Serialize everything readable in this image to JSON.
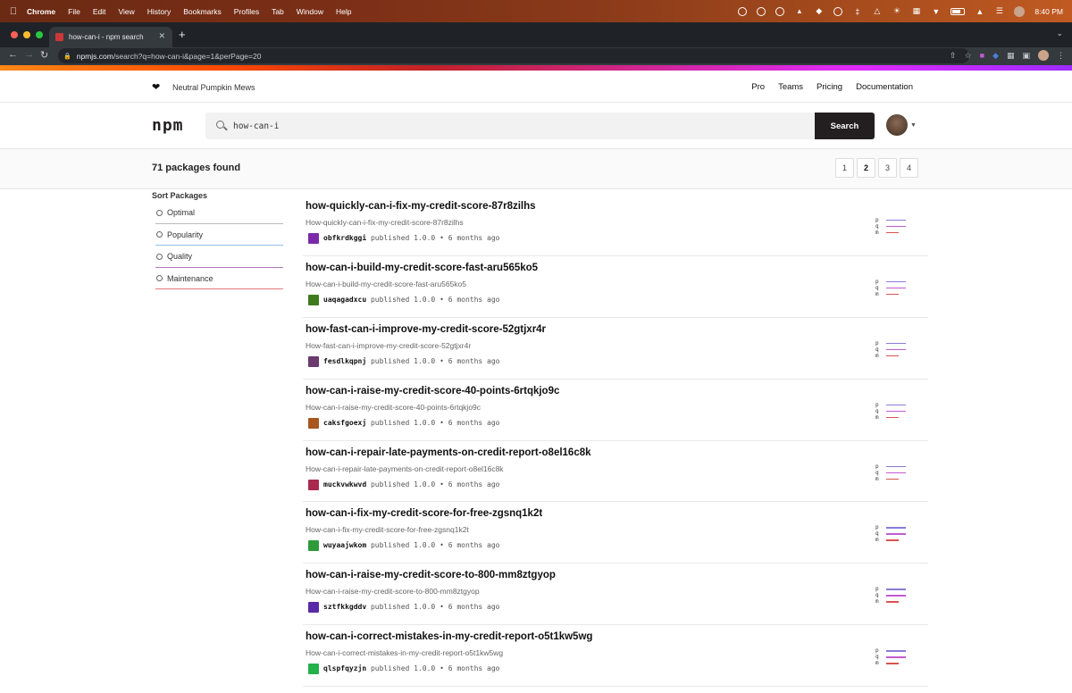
{
  "menubar": {
    "app_name": "Chrome",
    "menus": [
      "File",
      "Edit",
      "View",
      "History",
      "Bookmarks",
      "Profiles",
      "Tab",
      "Window",
      "Help"
    ],
    "time": "8:40 PM"
  },
  "browser": {
    "tab_title": "how-can-i - npm search",
    "url_host": "npmjs.com",
    "url_path": "/search?q=how-can-i&page=1&perPage=20"
  },
  "header": {
    "slogan": "Neutral Pumpkin Mews",
    "nav": [
      "Pro",
      "Teams",
      "Pricing",
      "Documentation"
    ],
    "logo": "npm"
  },
  "search": {
    "query": "how-can-i",
    "button_label": "Search"
  },
  "results_summary": {
    "count_text": "71 packages found",
    "pages": [
      "1",
      "2",
      "3",
      "4"
    ],
    "current_page": "2"
  },
  "sidebar": {
    "title": "Sort Packages",
    "options": [
      {
        "label": "Optimal",
        "color": "#bbbbbb"
      },
      {
        "label": "Popularity",
        "color": "#8fc2ec"
      },
      {
        "label": "Quality",
        "color": "#b17bbd"
      },
      {
        "label": "Maintenance",
        "color": "#e07a7a"
      }
    ]
  },
  "score_colors": {
    "p": "#8a7bd8",
    "q": "#c35bd1",
    "m": "#d9534f"
  },
  "packages": [
    {
      "name": "how-quickly-can-i-fix-my-credit-score-87r8zilhs",
      "desc": "How-quickly-can-i-fix-my-credit-score-87r8zilhs",
      "publisher": "obfkrdkggi",
      "version": "1.0.0",
      "ago": "6 months ago",
      "avatar_color": "#7a2aa8"
    },
    {
      "name": "how-can-i-build-my-credit-score-fast-aru565ko5",
      "desc": "How-can-i-build-my-credit-score-fast-aru565ko5",
      "publisher": "uaqagadxcu",
      "version": "1.0.0",
      "ago": "6 months ago",
      "avatar_color": "#3f7a1e"
    },
    {
      "name": "how-fast-can-i-improve-my-credit-score-52gtjxr4r",
      "desc": "How-fast-can-i-improve-my-credit-score-52gtjxr4r",
      "publisher": "fesdlkqpnj",
      "version": "1.0.0",
      "ago": "6 months ago",
      "avatar_color": "#6b3a6e"
    },
    {
      "name": "how-can-i-raise-my-credit-score-40-points-6rtqkjo9c",
      "desc": "How-can-i-raise-my-credit-score-40-points-6rtqkjo9c",
      "publisher": "caksfgoexj",
      "version": "1.0.0",
      "ago": "6 months ago",
      "avatar_color": "#a8561e"
    },
    {
      "name": "how-can-i-repair-late-payments-on-credit-report-o8el16c8k",
      "desc": "How-can-i-repair-late-payments-on-credit-report-o8el16c8k",
      "publisher": "muckvwkwvd",
      "version": "1.0.0",
      "ago": "6 months ago",
      "avatar_color": "#a82a4e"
    },
    {
      "name": "how-can-i-fix-my-credit-score-for-free-zgsnq1k2t",
      "desc": "How-can-i-fix-my-credit-score-for-free-zgsnq1k2t",
      "publisher": "wuyaajwkom",
      "version": "1.0.0",
      "ago": "6 months ago",
      "avatar_color": "#2e9a3a"
    },
    {
      "name": "how-can-i-raise-my-credit-score-to-800-mm8ztgyop",
      "desc": "How-can-i-raise-my-credit-score-to-800-mm8ztgyop",
      "publisher": "sztfkkgddv",
      "version": "1.0.0",
      "ago": "6 months ago",
      "avatar_color": "#5a2aa8"
    },
    {
      "name": "how-can-i-correct-mistakes-in-my-credit-report-o5t1kw5wg",
      "desc": "How-can-i-correct-mistakes-in-my-credit-report-o5t1kw5wg",
      "publisher": "qlspfqyzjn",
      "version": "1.0.0",
      "ago": "6 months ago",
      "avatar_color": "#22b04a"
    }
  ]
}
